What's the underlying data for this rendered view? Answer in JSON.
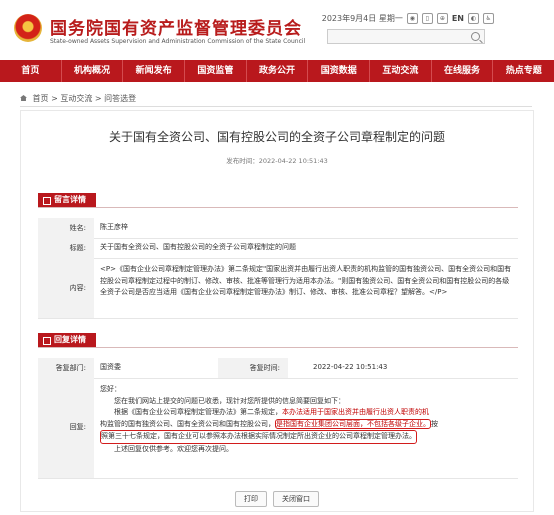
{
  "header": {
    "site_title": "国务院国有资产监督管理委员会",
    "site_subtitle": "State-owned Assets Supervision and Administration Commission of the State Council",
    "date": "2023年9月4日 星期一",
    "lang": "EN",
    "search_placeholder": ""
  },
  "nav": [
    "首页",
    "机构概况",
    "新闻发布",
    "国资监管",
    "政务公开",
    "国资数据",
    "互动交流",
    "在线服务",
    "热点专题"
  ],
  "breadcrumb": [
    "首页",
    "互动交流",
    "问答选登"
  ],
  "article": {
    "title": "关于国有全资公司、国有控股公司的全资子公司章程制定的问题",
    "pub_date": "发布时间：2022-04-22 10:51:43"
  },
  "message": {
    "section_label": "留言详情",
    "name_label": "姓名:",
    "name": "陈王彦梓",
    "subject_label": "标题:",
    "subject": "关于国有全资公司、国有控股公司的全资子公司章程制定的问题",
    "content_label": "内容:",
    "content": "<P>《国有企业公司章程制定管理办法》第二条规定\"国家出资并由履行出资人职责的机构监管的国有独资公司、国有全资公司和国有控股公司章程制定过程中的制订、修改、审核、批准等管理行为适用本办法。\"则国有独资公司、国有全资公司和国有控股公司的各级全资子公司是否应当适用《国有企业公司章程制定管理办法》制订、修改、审核、批准公司章程？望解答。</P>"
  },
  "reply": {
    "section_label": "回复详情",
    "dept_label": "答复部门:",
    "dept": "国资委",
    "time_label": "答复时间:",
    "time": "2022-04-22 10:51:43",
    "reply_label": "回复:",
    "greeting": "您好：",
    "line1": "您在我们网站上提交的问题已收悉，现针对您所提供的信息简要回复如下：",
    "line2a": "根据《国有企业公司章程制定管理办法》第二条规定，",
    "line2b": "本办法适用于国家出资并由履行出资人职责的机",
    "line3a": "构监管的国有独资公司、国有全资公司和国有控股公司，",
    "line3b": "是指国有企业集团公司层面，不包括各级子企业。",
    "line3c": "按",
    "line4": "照第三十七条规定，国有企业可以参照本办法根据实际情况制定所出资企业的公司章程制定管理办法。",
    "line5": "上述回复仅供参考。欢迎您再次提问。"
  },
  "buttons": {
    "print": "打印",
    "close": "关闭窗口"
  }
}
